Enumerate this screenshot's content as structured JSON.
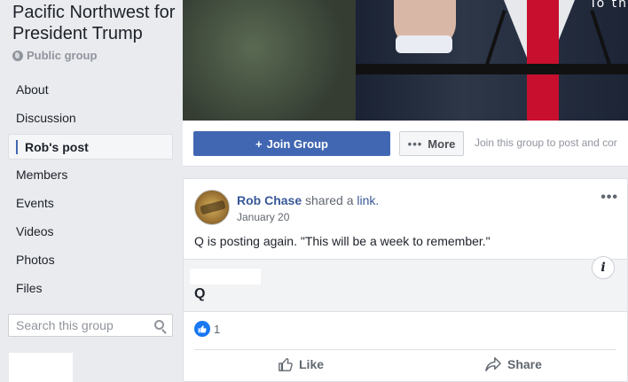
{
  "group": {
    "title": "Pacific Northwest for President Trump",
    "privacy": "Public group"
  },
  "nav": {
    "items": [
      {
        "label": "About",
        "active": false
      },
      {
        "label": "Discussion",
        "active": false
      },
      {
        "label": "Rob's post",
        "active": true
      },
      {
        "label": "Members",
        "active": false
      },
      {
        "label": "Events",
        "active": false
      },
      {
        "label": "Videos",
        "active": false
      },
      {
        "label": "Photos",
        "active": false
      },
      {
        "label": "Files",
        "active": false
      }
    ]
  },
  "search": {
    "placeholder": "Search this group"
  },
  "cover": {
    "caption": "To th"
  },
  "actions": {
    "join_label": "Join Group",
    "join_plus": "+",
    "more_label": "More",
    "more_dots": "•••",
    "join_hint": "Join this group to post and cor"
  },
  "post": {
    "author": "Rob Chase",
    "shared_text": " shared a ",
    "link_word": "link.",
    "date": "January 20",
    "menu": "•••",
    "text": "Q is posting again. \"This will be a week to remember.\"",
    "link_title": "Q",
    "info_glyph": "i",
    "like_count": "1",
    "like_label": "Like",
    "share_label": "Share"
  },
  "colors": {
    "brand": "#4267b2",
    "link": "#385898",
    "like_badge": "#1877f2"
  }
}
